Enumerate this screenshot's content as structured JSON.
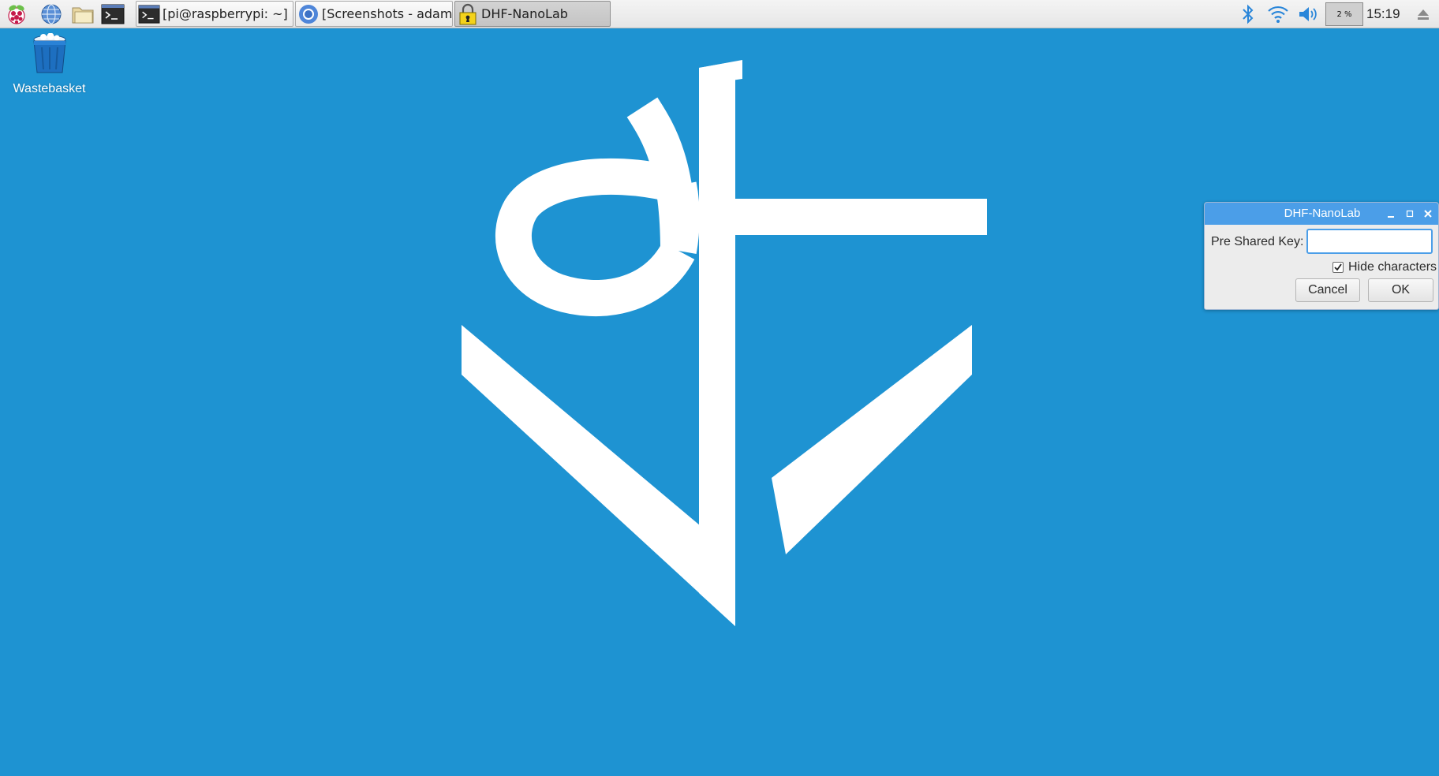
{
  "taskbar": {
    "launchers": [
      {
        "icon": "raspberry-menu-icon"
      },
      {
        "icon": "web-browser-icon"
      },
      {
        "icon": "file-manager-icon"
      },
      {
        "icon": "terminal-icon"
      }
    ],
    "tasks": [
      {
        "label": "[pi@raspberrypi: ~]",
        "icon": "terminal-icon",
        "active": false
      },
      {
        "label": "[Screenshots - adam...",
        "icon": "chromium-icon",
        "active": false
      },
      {
        "label": "DHF-NanoLab",
        "icon": "lock-icon",
        "active": true
      }
    ],
    "tray": {
      "bluetooth_icon": "bluetooth-icon",
      "wifi_icon": "wifi-icon",
      "volume_icon": "volume-icon",
      "cpu_usage": "2 %",
      "clock": "15:19",
      "eject_icon": "eject-icon"
    }
  },
  "desktop": {
    "background_color": "#1e93d2",
    "icons": [
      {
        "label": "Wastebasket",
        "icon": "wastebasket-icon"
      }
    ],
    "logo_icon": "dhf-logo-icon"
  },
  "dialog": {
    "title": "DHF-NanoLab",
    "titlebar_color": "#4b9ee8",
    "psk_label": "Pre Shared Key:",
    "psk_value": "",
    "hide_characters_label": "Hide characters",
    "hide_characters_checked": true,
    "cancel_label": "Cancel",
    "ok_label": "OK"
  }
}
